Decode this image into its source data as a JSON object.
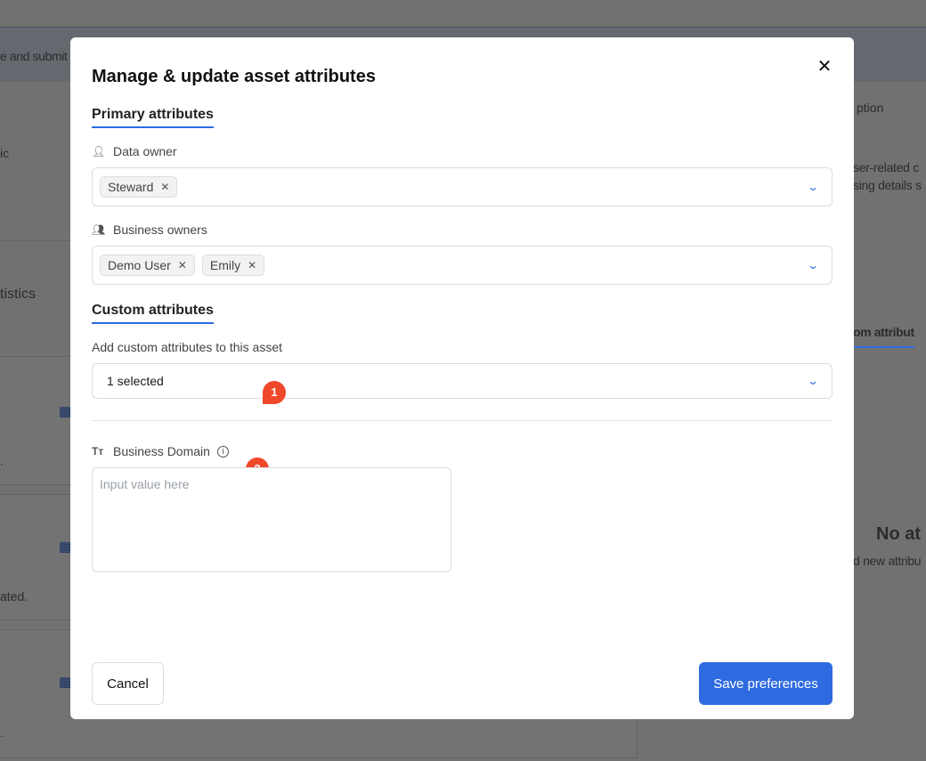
{
  "background": {
    "fragments": [
      "e and submit",
      "ic",
      "tistics",
      ".",
      "ated.",
      ".",
      "ption",
      "ser-related c",
      "sing details s",
      "om attribut",
      "No at",
      "d new attribu"
    ]
  },
  "modal": {
    "title": "Manage & update asset attributes",
    "primary_section": "Primary attributes",
    "data_owner": {
      "label": "Data owner",
      "chips": [
        "Steward"
      ]
    },
    "business_owners": {
      "label": "Business owners",
      "chips": [
        "Demo User",
        "Emily"
      ]
    },
    "custom_section": "Custom attributes",
    "custom_label": "Add custom attributes to this asset",
    "custom_select_value": "1 selected",
    "business_domain": {
      "label": "Business Domain",
      "placeholder": "Input value here"
    },
    "badges": [
      "1",
      "2"
    ],
    "cancel_label": "Cancel",
    "save_label": "Save preferences"
  },
  "colors": {
    "accent": "#2f6be0",
    "badge": "#f0482a"
  }
}
